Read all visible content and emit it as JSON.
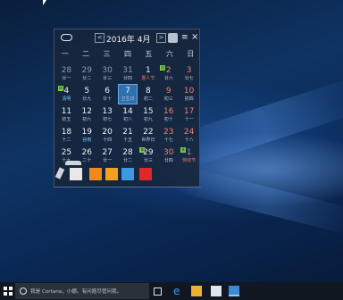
{
  "calendar": {
    "title": "2016年 4月",
    "prev": "<",
    "next": ">",
    "menu": "≡",
    "close": "×",
    "weekdays": [
      "一",
      "二",
      "三",
      "四",
      "五",
      "六",
      "日"
    ],
    "days": [
      {
        "d": "28",
        "l": "廿一",
        "dim": true
      },
      {
        "d": "29",
        "l": "廿二",
        "dim": true
      },
      {
        "d": "30",
        "l": "廿三",
        "dim": true
      },
      {
        "d": "31",
        "l": "廿四",
        "dim": true
      },
      {
        "d": "1",
        "l": "愚人节",
        "red": true
      },
      {
        "d": "2",
        "l": "廿六",
        "wk": true,
        "tag": "班"
      },
      {
        "d": "3",
        "l": "廿七",
        "wk": true
      },
      {
        "d": "4",
        "l": "清明",
        "blue": true,
        "tag": "休"
      },
      {
        "d": "5",
        "l": "廿九"
      },
      {
        "d": "6",
        "l": "廿十"
      },
      {
        "d": "7",
        "l": "卫生日",
        "today": true
      },
      {
        "d": "8",
        "l": "初二"
      },
      {
        "d": "9",
        "l": "初三",
        "wk": true
      },
      {
        "d": "10",
        "l": "初四",
        "wk": true
      },
      {
        "d": "11",
        "l": "初五"
      },
      {
        "d": "12",
        "l": "初六"
      },
      {
        "d": "13",
        "l": "初七"
      },
      {
        "d": "14",
        "l": "初八"
      },
      {
        "d": "15",
        "l": "初九"
      },
      {
        "d": "16",
        "l": "初十",
        "wk": true
      },
      {
        "d": "17",
        "l": "十一",
        "wk": true
      },
      {
        "d": "18",
        "l": "十二"
      },
      {
        "d": "19",
        "l": "谷雨",
        "blue": true
      },
      {
        "d": "20",
        "l": "十四"
      },
      {
        "d": "21",
        "l": "十五"
      },
      {
        "d": "22",
        "l": "世界日"
      },
      {
        "d": "23",
        "l": "十七",
        "wk": true
      },
      {
        "d": "24",
        "l": "十八",
        "wk": true
      },
      {
        "d": "25",
        "l": "十九"
      },
      {
        "d": "26",
        "l": "二十"
      },
      {
        "d": "27",
        "l": "廿一"
      },
      {
        "d": "28",
        "l": "廿二"
      },
      {
        "d": "29",
        "l": "廿三",
        "tag": "休"
      },
      {
        "d": "30",
        "l": "廿四",
        "wk": true
      },
      {
        "d": "1",
        "l": "劳动节",
        "dim": true,
        "red": true,
        "tag": "休"
      }
    ]
  },
  "taskbar": {
    "search_placeholder": "我是 Cortana，小娜。有问题尽管问我。"
  }
}
